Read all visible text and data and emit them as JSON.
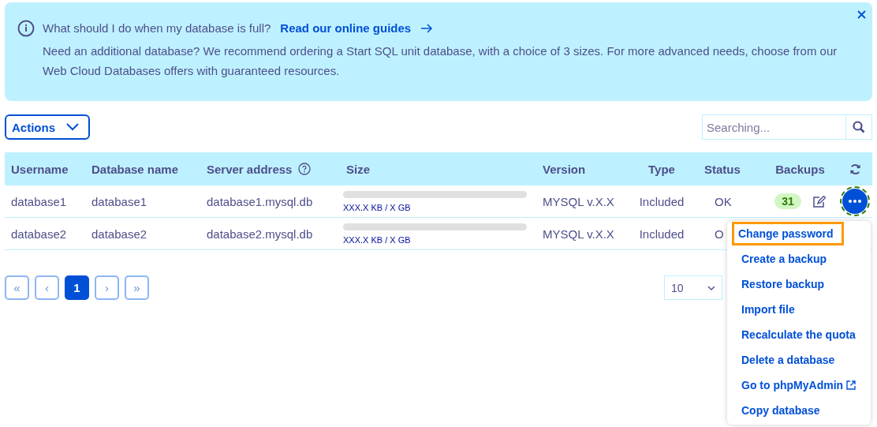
{
  "banner": {
    "question": "What should I do when my database is full?",
    "link": "Read our online guides",
    "text": "Need an additional database? We recommend ordering a Start SQL unit database, with a choice of 3 sizes. For more advanced needs, choose from our Web Cloud Databases offers with guaranteed resources.",
    "closable": true
  },
  "actions": {
    "label": "Actions"
  },
  "search": {
    "placeholder": "Searching..."
  },
  "table": {
    "columns": [
      "Username",
      "Database name",
      "Server address",
      "Size",
      "Version",
      "Type",
      "Status",
      "Backups"
    ],
    "rows": [
      {
        "username": "database1",
        "database": "database1",
        "server": "database1.mysql.db",
        "size": {
          "level": 0,
          "reading": "XXX.X KB / X GB"
        },
        "version": "MYSQL v.X.X",
        "type": "Included",
        "status": "OK",
        "backups": "31",
        "menu_open": true
      },
      {
        "username": "database2",
        "database": "database2",
        "server": "database2.mysql.db",
        "size": {
          "level": 0,
          "reading": "XXX.X KB / X GB"
        },
        "version": "MYSQL v.X.X",
        "type": "Included",
        "status": "O",
        "backups": null,
        "menu_open": false
      }
    ]
  },
  "pagination": {
    "first": "«",
    "prev": "‹",
    "pages": [
      {
        "label": "1",
        "selected": true
      }
    ],
    "next": "›",
    "last": "»",
    "page_size": "10"
  },
  "menu": {
    "items": [
      {
        "label": "Change password",
        "highlighted": true,
        "external": false
      },
      {
        "label": "Create a backup",
        "highlighted": false,
        "external": false
      },
      {
        "label": "Restore backup",
        "highlighted": false,
        "external": false
      },
      {
        "label": "Import file",
        "highlighted": false,
        "external": false
      },
      {
        "label": "Recalculate the quota",
        "highlighted": false,
        "external": false
      },
      {
        "label": "Delete a database",
        "highlighted": false,
        "external": false
      },
      {
        "label": "Go to phpMyAdmin",
        "highlighted": false,
        "external": true
      },
      {
        "label": "Copy database",
        "highlighted": false,
        "external": false
      }
    ]
  }
}
